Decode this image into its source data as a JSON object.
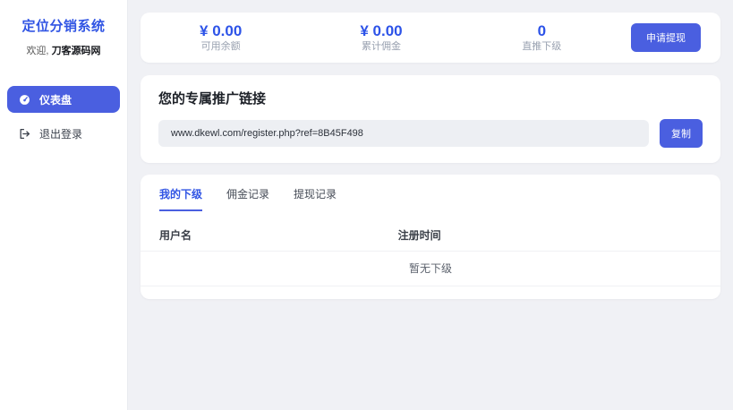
{
  "app": {
    "title": "定位分销系统",
    "welcome_prefix": "欢迎,",
    "username": "刀客源码网"
  },
  "sidebar": {
    "nav": [
      {
        "label": "仪表盘",
        "icon": "gauge-icon",
        "active": true
      },
      {
        "label": "退出登录",
        "icon": "logout-icon",
        "active": false
      }
    ]
  },
  "stats": {
    "items": [
      {
        "value": "¥ 0.00",
        "label": "可用余额"
      },
      {
        "value": "¥ 0.00",
        "label": "累计佣金"
      },
      {
        "value": "0",
        "label": "直推下级"
      }
    ],
    "withdraw_button": "申请提现"
  },
  "referral": {
    "title": "您的专属推广链接",
    "link": "www.dkewl.com/register.php?ref=8B45F498",
    "copy_button": "复制"
  },
  "tabs": [
    {
      "label": "我的下级",
      "active": true
    },
    {
      "label": "佣金记录",
      "active": false
    },
    {
      "label": "提现记录",
      "active": false
    }
  ],
  "table": {
    "headers": [
      "用户名",
      "注册时间"
    ],
    "empty_text": "暂无下级"
  },
  "colors": {
    "primary": "#4a5fe0",
    "accent_text": "#2d53e8",
    "page_bg": "#f0f1f5",
    "input_bg": "#edeff3"
  }
}
